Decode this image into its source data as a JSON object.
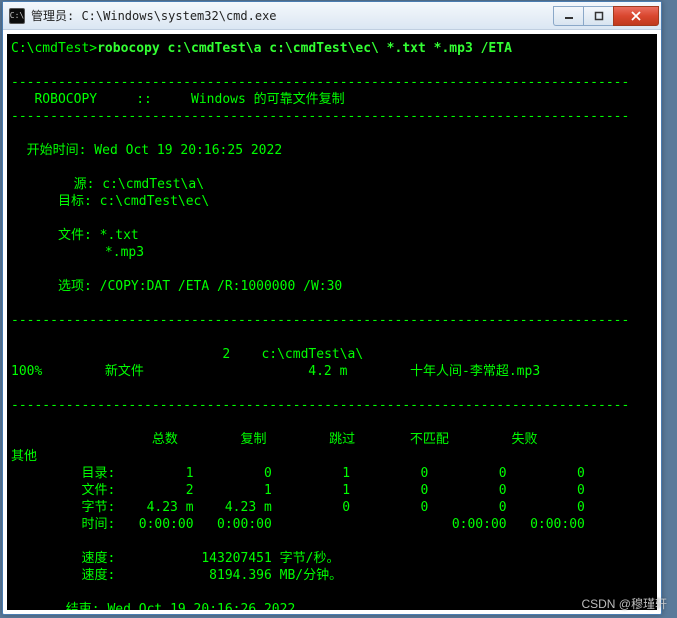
{
  "window": {
    "title": "管理员: C:\\Windows\\system32\\cmd.exe",
    "icon_glyph": "C:\\"
  },
  "controls": {
    "minimize_label": "minimize",
    "maximize_label": "maximize",
    "close_label": "close"
  },
  "terminal": {
    "prompt": "C:\\cmdTest>",
    "command": "robocopy c:\\cmdTest\\a c:\\cmdTest\\ec\\ *.txt *.mp3 /ETA",
    "divider": "-------------------------------------------------------------------------------",
    "header_line": "   ROBOCOPY     ::     Windows 的可靠文件复制                              ",
    "start_label": "  开始时间:",
    "start_time": " Wed Oct 19 20:16:25 2022",
    "src_label": "        源:",
    "src_value": " c:\\cmdTest\\a\\",
    "dst_label": "      目标:",
    "dst_value": " c:\\cmdTest\\ec\\",
    "files_label": "      文件:",
    "files_value1": " *.txt",
    "files_value2": "            *.mp3",
    "options_label": "      选项:",
    "options_value": " /COPY:DAT /ETA /R:1000000 /W:30",
    "dir_listing": "                           2    c:\\cmdTest\\a\\",
    "progress_line": "100%        新文件                     4.2 m        十年人间-李常超.mp3",
    "summary_header": "                  总数        复制        跳过       不匹配        失败",
    "summary_extra": "其他",
    "row_dirs": "         目录:         1         0         1         0         0         0",
    "row_files": "         文件:         2         1         1         0         0         0",
    "row_bytes": "         字节:    4.23 m    4.23 m         0         0         0         0",
    "row_time": "         时间:   0:00:00   0:00:00                       0:00:00   0:00:00",
    "speed1": "         速度:           143207451 字节/秒。",
    "speed2": "         速度:            8194.396 MB/分钟。",
    "end_label": "       结束:",
    "end_time": " Wed Oct 19 20:16:26 2022"
  },
  "watermark": "CSDN @穆瑾轩"
}
